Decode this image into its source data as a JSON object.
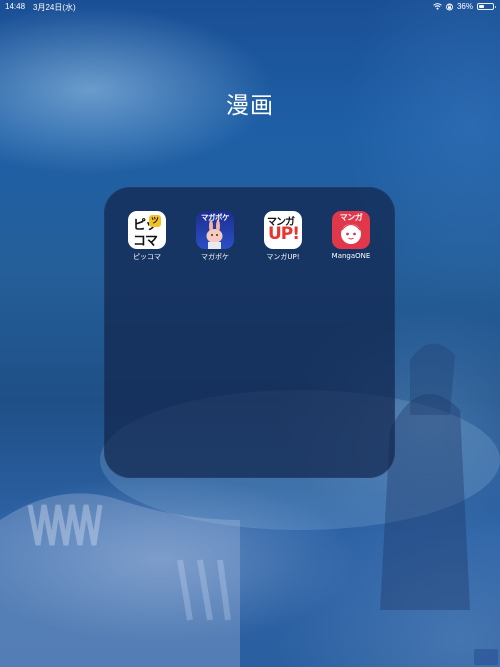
{
  "status_bar": {
    "time": "14:48",
    "date": "3月24日(水)",
    "battery": "36%",
    "battery_level": 0.36,
    "icons": [
      "wifi-icon",
      "lock-rotation-icon",
      "battery-icon"
    ]
  },
  "folder": {
    "title": "漫画",
    "apps": [
      {
        "label": "ピッコマ",
        "icon": "piccoma-app-icon",
        "icon_text_top": "ピッ",
        "icon_badge": "ツ",
        "icon_text_bottom": "コマ",
        "color": "#f5c12a"
      },
      {
        "label": "マガポケ",
        "icon": "magapoke-app-icon",
        "icon_text": "マガポケ",
        "color": "#1d2e8f"
      },
      {
        "label": "マンガUP!",
        "icon": "mangaup-app-icon",
        "icon_text_top": "マンガ",
        "icon_text_bottom": "UP!",
        "color": "#e8352f"
      },
      {
        "label": "MangaONE",
        "icon": "mangaone-app-icon",
        "icon_text": "マンガ",
        "color": "#e0384a"
      }
    ]
  },
  "colors": {
    "wallpaper": "#1e5fa6",
    "folder_background": "#12264e"
  }
}
